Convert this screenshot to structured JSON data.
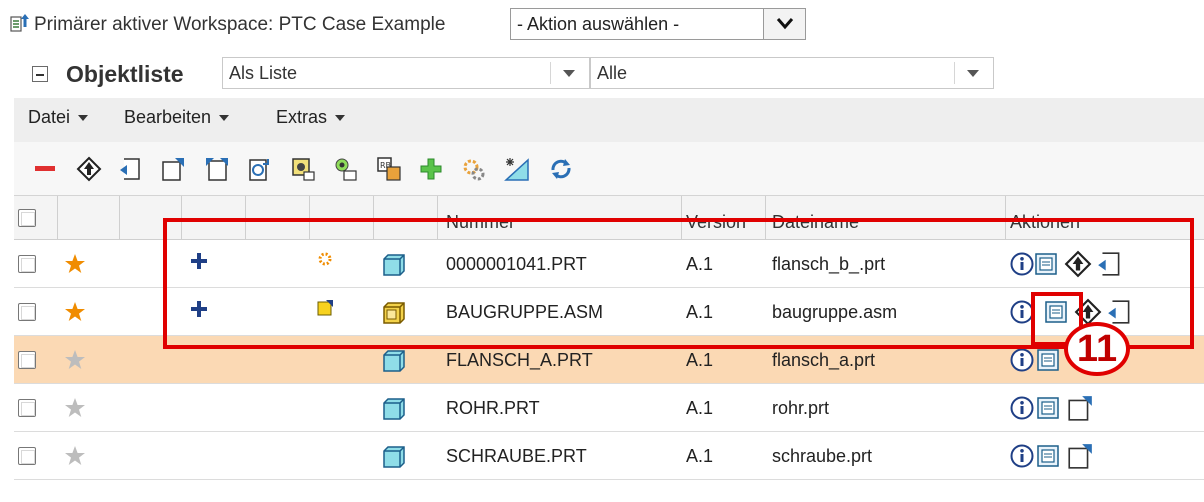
{
  "workspace": {
    "label": "Primärer aktiver Workspace: PTC Case Example",
    "action_select": "- Aktion auswählen -"
  },
  "object_list": {
    "title": "Objektliste",
    "view_select": "Als Liste",
    "filter_select": "Alle"
  },
  "menu": {
    "items": [
      {
        "label": "Datei"
      },
      {
        "label": "Bearbeiten"
      },
      {
        "label": "Extras"
      }
    ]
  },
  "toolbar": {
    "icons": [
      "remove-icon",
      "check-in-icon",
      "open-icon",
      "check-out-icon",
      "undo-checkout-icon",
      "update-icon",
      "synchronize-icon",
      "rename-icon",
      "add-icon",
      "regenerate-icon",
      "new-object-icon",
      "refresh-icon"
    ]
  },
  "table": {
    "columns": {
      "number": "Nummer",
      "version": "Version",
      "filename": "Dateiname",
      "actions": "Aktionen"
    },
    "rows": [
      {
        "favorite": true,
        "modified": true,
        "status": "new-icon",
        "type": "part",
        "number": "0000001041.PRT",
        "version": "A.1",
        "filename": "flansch_b_.prt",
        "action3": "check-in-icon",
        "action4": "open-icon"
      },
      {
        "favorite": true,
        "modified": true,
        "status": "modified-icon",
        "type": "assembly",
        "number": "BAUGRUPPE.ASM",
        "version": "A.1",
        "filename": "baugruppe.asm",
        "action3": "check-in-icon",
        "action4": "open-icon"
      },
      {
        "favorite": false,
        "modified": false,
        "status": "",
        "type": "part",
        "number": "FLANSCH_A.PRT",
        "version": "A.1",
        "filename": "flansch_a.prt",
        "action3": "",
        "action4": ""
      },
      {
        "favorite": false,
        "modified": false,
        "status": "",
        "type": "part",
        "number": "ROHR.PRT",
        "version": "A.1",
        "filename": "rohr.prt",
        "action3": "check-out-icon",
        "action4": ""
      },
      {
        "favorite": false,
        "modified": false,
        "status": "",
        "type": "part",
        "number": "SCHRAUBE.PRT",
        "version": "A.1",
        "filename": "schraube.prt",
        "action3": "check-out-icon",
        "action4": ""
      }
    ]
  },
  "annotation": {
    "callout": "11",
    "color": "#e00000"
  },
  "colors": {
    "highlight_row": "#fbd9b4",
    "star_active": "#f08c00",
    "star_inactive": "#bdbdbd",
    "part_icon": "#8fdde8"
  }
}
